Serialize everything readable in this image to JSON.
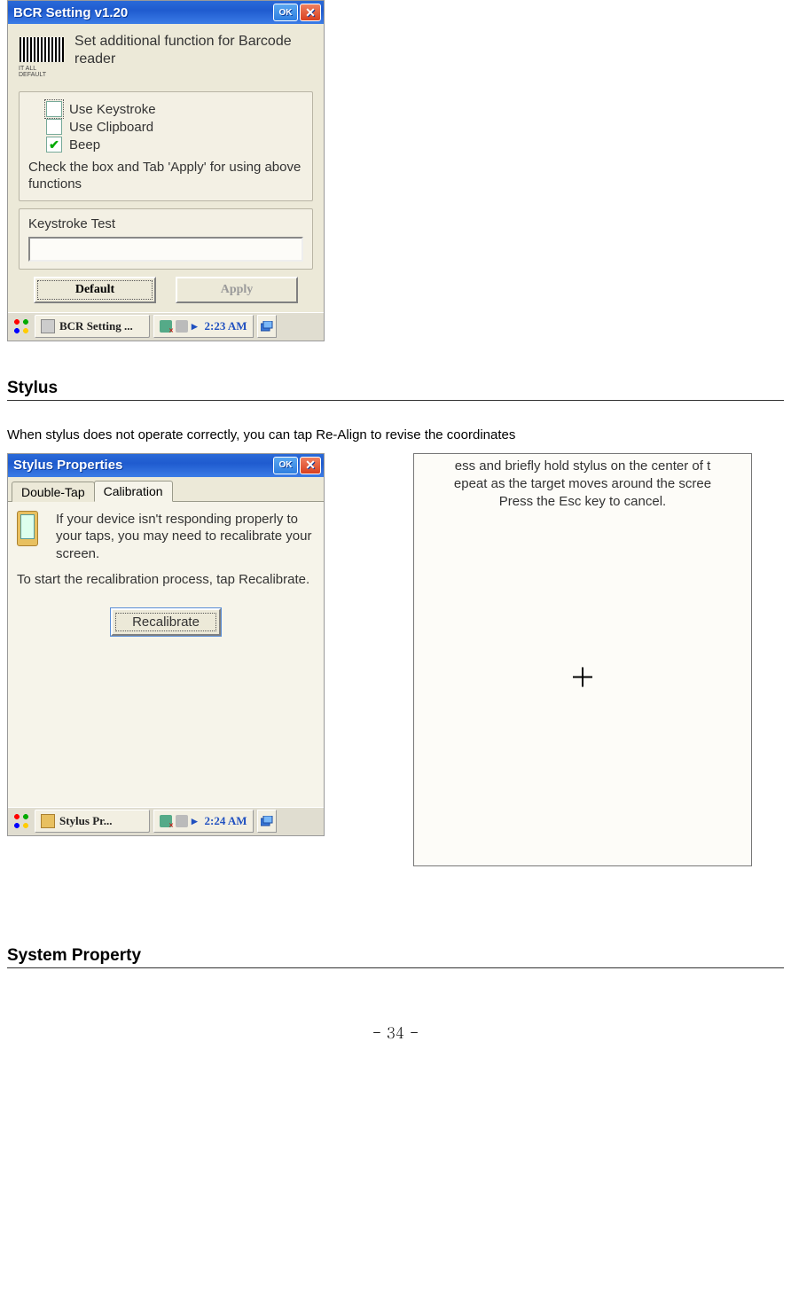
{
  "bcr": {
    "title": "BCR Setting v1.20",
    "ok": "OK",
    "icon_sub": "IT ALL DEFAULT",
    "desc": "Set additional function for Barcode reader",
    "opts": {
      "use_keystroke": "Use Keystroke",
      "use_clipboard": "Use Clipboard",
      "beep": "Beep"
    },
    "instr": "Check the box and Tab 'Apply' for using above functions",
    "test_title": "Keystroke Test",
    "btn_default": "Default",
    "btn_apply": "Apply",
    "task_app": "BCR Setting ...",
    "clock": "2:23 AM"
  },
  "section_stylus": "Stylus",
  "stylus_para": "When stylus does not operate correctly, you can tap Re-Align to revise the coordinates",
  "stylus": {
    "title": "Stylus Properties",
    "ok": "OK",
    "tab_doubletap": "Double-Tap",
    "tab_calibration": "Calibration",
    "text1": "If your device isn't responding properly to your taps, you may need to recalibrate your screen.",
    "text2": "To start the recalibration process, tap Recalibrate.",
    "btn_recalibrate": "Recalibrate",
    "task_app": "Stylus Pr...",
    "clock": "2:24 AM"
  },
  "calib": {
    "line1": "ess and briefly hold stylus on the center of t",
    "line2": "epeat as the target moves around the scree",
    "line3": "Press the Esc key to cancel."
  },
  "section_system": "System Property",
  "page_number": "- 34 -"
}
